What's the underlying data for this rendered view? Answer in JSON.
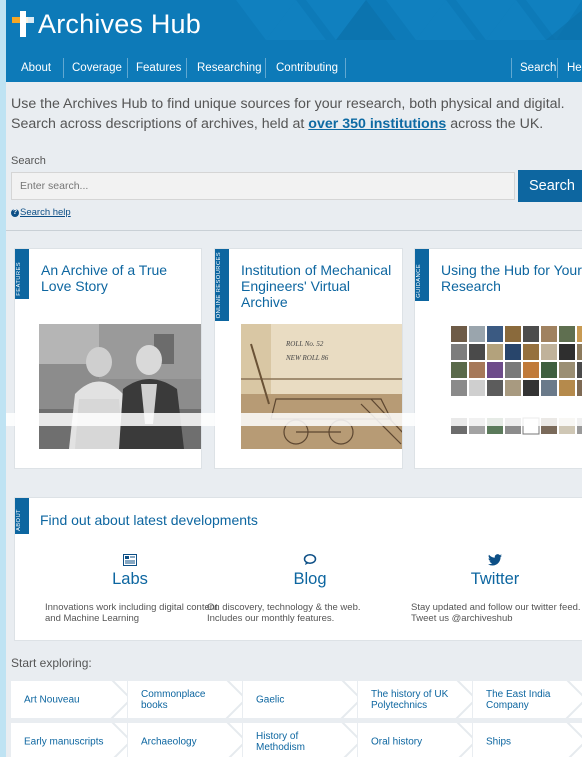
{
  "header": {
    "site_title": "Archives Hub",
    "nav": [
      "About",
      "Coverage",
      "Features",
      "Researching",
      "Contributing"
    ],
    "nav_right": [
      "Search",
      "He"
    ]
  },
  "intro": {
    "text_before": "Use the Archives Hub to find unique sources for your research, both physical and digital. Search across descriptions of archives, held at ",
    "link": "over 350 institutions",
    "text_after": " across the UK."
  },
  "search": {
    "label": "Search",
    "placeholder": "Enter search...",
    "button": "Search",
    "help": "Search help",
    "help_icon": "question-circle-icon"
  },
  "cards": [
    {
      "tag": "FEATURES",
      "title": "An Archive of a True Love Story"
    },
    {
      "tag": "ONLINE RESOURCES",
      "title": "Institution of Mechanical Engineers' Virtual Archive",
      "img_text_1": "ROLL No. 52",
      "img_text_2": "NEW ROLL 86"
    },
    {
      "tag": "GUIDANCE",
      "title": "Using the Hub for Your Research"
    }
  ],
  "about": {
    "tag": "ABOUT",
    "title": "Find out about latest developments",
    "items": [
      {
        "icon": "newspaper-icon",
        "title": "Labs",
        "desc": "Innovations work including digital content and Machine Learning"
      },
      {
        "icon": "speech-bubble-icon",
        "title": "Blog",
        "desc": "On discovery, technology & the web. Includes our monthly features."
      },
      {
        "icon": "twitter-bird-icon",
        "title": "Twitter",
        "desc": "Stay updated and follow our twitter feed. Tweet us @archiveshub"
      }
    ]
  },
  "explore": {
    "label": "Start exploring:",
    "row1": [
      "Art Nouveau",
      "Commonplace books",
      "Gaelic",
      "The history of UK Polytechnics",
      "The East India Company"
    ],
    "row2": [
      "Early manuscripts",
      "Archaeology",
      "History of Methodism",
      "Oral history",
      "Ships"
    ]
  },
  "colors": {
    "accent": "#0d66a0",
    "header": "#0d7ab8",
    "logo_orange": "#f5a623"
  }
}
